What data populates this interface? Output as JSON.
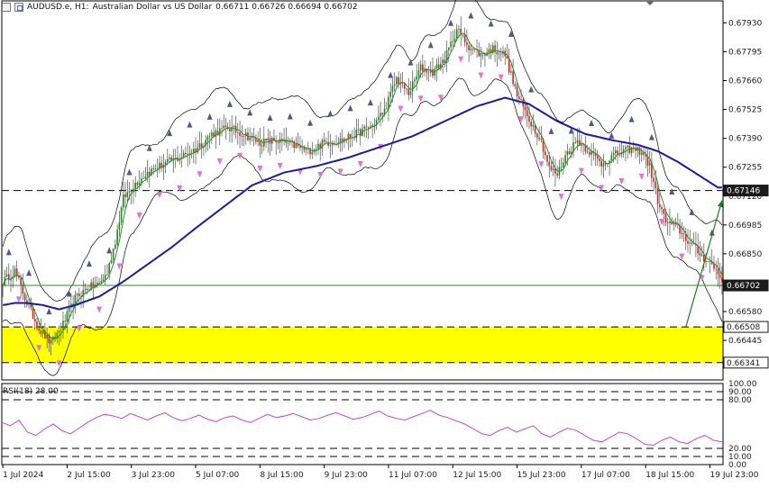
{
  "header": {
    "symbol": "AUDUSD.e, H1:",
    "description": "Australian Dollar vs US Dollar",
    "ohlc": "0.66711 0.66726 0.66694 0.66702"
  },
  "rsi_header": "RSI(18) 28.00",
  "chart_data": [
    {
      "type": "line",
      "name": "price",
      "ylim": [
        0.6626,
        0.6802
      ],
      "price_ticks": [
        "0.67930",
        "0.67795",
        "0.67660",
        "0.67525",
        "0.67390",
        "0.67255",
        "0.67120",
        "0.66985",
        "0.66850",
        "0.66580",
        "0.66445"
      ],
      "price_tick_values": [
        0.6793,
        0.67795,
        0.6766,
        0.67525,
        0.6739,
        0.67255,
        0.6712,
        0.66985,
        0.6685,
        0.6658,
        0.66445
      ],
      "price_labels": [
        {
          "text": "0.67146",
          "value": 0.67146,
          "style": "dark"
        },
        {
          "text": "0.66702",
          "value": 0.66702,
          "style": "dark"
        },
        {
          "text": "0.66508",
          "value": 0.66508,
          "style": "light"
        },
        {
          "text": "0.66341",
          "value": 0.66341,
          "style": "light"
        }
      ],
      "x_labels": [
        "1 Jul 2024",
        "2 Jul 15:00",
        "3 Jul 23:00",
        "5 Jul 07:00",
        "8 Jul 15:00",
        "9 Jul 23:00",
        "11 Jul 07:00",
        "12 Jul 15:00",
        "15 Jul 23:00",
        "17 Jul 07:00",
        "18 Jul 15:00",
        "19 Jul 23:00"
      ],
      "x_label_bars": [
        0,
        32,
        64,
        96,
        128,
        160,
        192,
        224,
        256,
        288,
        320,
        352
      ],
      "n_bars": 359,
      "close_path": [
        [
          0,
          0.6672
        ],
        [
          6,
          0.6677
        ],
        [
          12,
          0.6662
        ],
        [
          18,
          0.665
        ],
        [
          24,
          0.6643
        ],
        [
          30,
          0.6652
        ],
        [
          36,
          0.6664
        ],
        [
          42,
          0.6669
        ],
        [
          48,
          0.6671
        ],
        [
          52,
          0.6676
        ],
        [
          56,
          0.6691
        ],
        [
          60,
          0.6711
        ],
        [
          66,
          0.6718
        ],
        [
          72,
          0.6723
        ],
        [
          80,
          0.6727
        ],
        [
          88,
          0.673
        ],
        [
          96,
          0.6734
        ],
        [
          104,
          0.6741
        ],
        [
          112,
          0.6744
        ],
        [
          120,
          0.6741
        ],
        [
          128,
          0.6737
        ],
        [
          136,
          0.6738
        ],
        [
          144,
          0.6736
        ],
        [
          152,
          0.6733
        ],
        [
          160,
          0.6737
        ],
        [
          168,
          0.6738
        ],
        [
          176,
          0.6741
        ],
        [
          184,
          0.6745
        ],
        [
          190,
          0.6752
        ],
        [
          196,
          0.6767
        ],
        [
          202,
          0.676
        ],
        [
          208,
          0.6772
        ],
        [
          214,
          0.677
        ],
        [
          220,
          0.6776
        ],
        [
          226,
          0.679
        ],
        [
          232,
          0.6782
        ],
        [
          238,
          0.6778
        ],
        [
          244,
          0.6781
        ],
        [
          250,
          0.6778
        ],
        [
          256,
          0.6759
        ],
        [
          262,
          0.6748
        ],
        [
          268,
          0.6738
        ],
        [
          272,
          0.6725
        ],
        [
          276,
          0.6722
        ],
        [
          280,
          0.6731
        ],
        [
          286,
          0.6738
        ],
        [
          292,
          0.6733
        ],
        [
          298,
          0.6727
        ],
        [
          304,
          0.6731
        ],
        [
          312,
          0.6734
        ],
        [
          318,
          0.6733
        ],
        [
          322,
          0.6726
        ],
        [
          326,
          0.671
        ],
        [
          330,
          0.67
        ],
        [
          336,
          0.6697
        ],
        [
          342,
          0.669
        ],
        [
          348,
          0.6684
        ],
        [
          352,
          0.6681
        ],
        [
          356,
          0.6676
        ],
        [
          359,
          0.667
        ]
      ],
      "ma_path": [
        [
          0,
          0.6661
        ],
        [
          6,
          0.6662
        ],
        [
          12,
          0.6662
        ],
        [
          20,
          0.6661
        ],
        [
          28,
          0.6659
        ],
        [
          36,
          0.6661
        ],
        [
          48,
          0.6665
        ],
        [
          60,
          0.6672
        ],
        [
          72,
          0.668
        ],
        [
          84,
          0.6688
        ],
        [
          96,
          0.6697
        ],
        [
          110,
          0.6707
        ],
        [
          124,
          0.6717
        ],
        [
          140,
          0.6723
        ],
        [
          156,
          0.6726
        ],
        [
          172,
          0.673
        ],
        [
          188,
          0.6735
        ],
        [
          204,
          0.674
        ],
        [
          220,
          0.6747
        ],
        [
          236,
          0.6754
        ],
        [
          250,
          0.6758
        ],
        [
          262,
          0.6755
        ],
        [
          276,
          0.6747
        ],
        [
          290,
          0.6741
        ],
        [
          304,
          0.6738
        ],
        [
          316,
          0.6736
        ],
        [
          326,
          0.6733
        ],
        [
          336,
          0.6728
        ],
        [
          346,
          0.6722
        ],
        [
          356,
          0.6716
        ]
      ],
      "bands_upper_offset": 0.0018,
      "bands_lower_offset": 0.0017,
      "yellow_zone": [
        0.66341,
        0.66508
      ],
      "horizontal_lines": [
        {
          "value": 0.67146,
          "style": "dashed",
          "color": "#000000"
        },
        {
          "value": 0.66702,
          "style": "solid",
          "color": "#2e8b2e"
        },
        {
          "value": 0.66508,
          "style": "dashed",
          "color": "#000000"
        },
        {
          "value": 0.66341,
          "style": "dashed",
          "color": "#000000"
        }
      ],
      "arrow": {
        "from": [
          340,
          0.66508
        ],
        "to": [
          358,
          0.671
        ],
        "color": "#1e7d1e"
      },
      "colors": {
        "bull": "#1a8c1a",
        "bear": "#d42020",
        "ma": "#1a1aa8",
        "bands": "#000000",
        "fractal_up": "#4a5a8a",
        "fractal_down": "#e070e0",
        "zone": "#ffff00",
        "smooth": "#2e8b2e"
      }
    },
    {
      "type": "line",
      "name": "RSI(18)",
      "ylim": [
        0,
        100
      ],
      "ticks": [
        "100.00",
        "90.00",
        "80.00",
        "20.00",
        "10.00",
        "0.00"
      ],
      "tick_values": [
        100,
        90,
        80,
        20,
        10,
        0
      ],
      "levels": [
        90,
        80,
        20,
        10
      ],
      "values": [
        52,
        48,
        55,
        40,
        36,
        44,
        50,
        42,
        38,
        45,
        52,
        58,
        62,
        60,
        57,
        63,
        59,
        55,
        60,
        64,
        58,
        54,
        57,
        61,
        56,
        53,
        58,
        60,
        55,
        52,
        57,
        62,
        58,
        60,
        63,
        59,
        55,
        57,
        61,
        64,
        60,
        56,
        58,
        62,
        66,
        60,
        57,
        55,
        59,
        63,
        67,
        61,
        58,
        54,
        50,
        44,
        38,
        36,
        42,
        46,
        40,
        44,
        48,
        38,
        34,
        40,
        45,
        42,
        36,
        30,
        28,
        34,
        40,
        38,
        32,
        25,
        24,
        30,
        34,
        28,
        26,
        32,
        36,
        30,
        28
      ],
      "color": "#cc44cc"
    }
  ]
}
